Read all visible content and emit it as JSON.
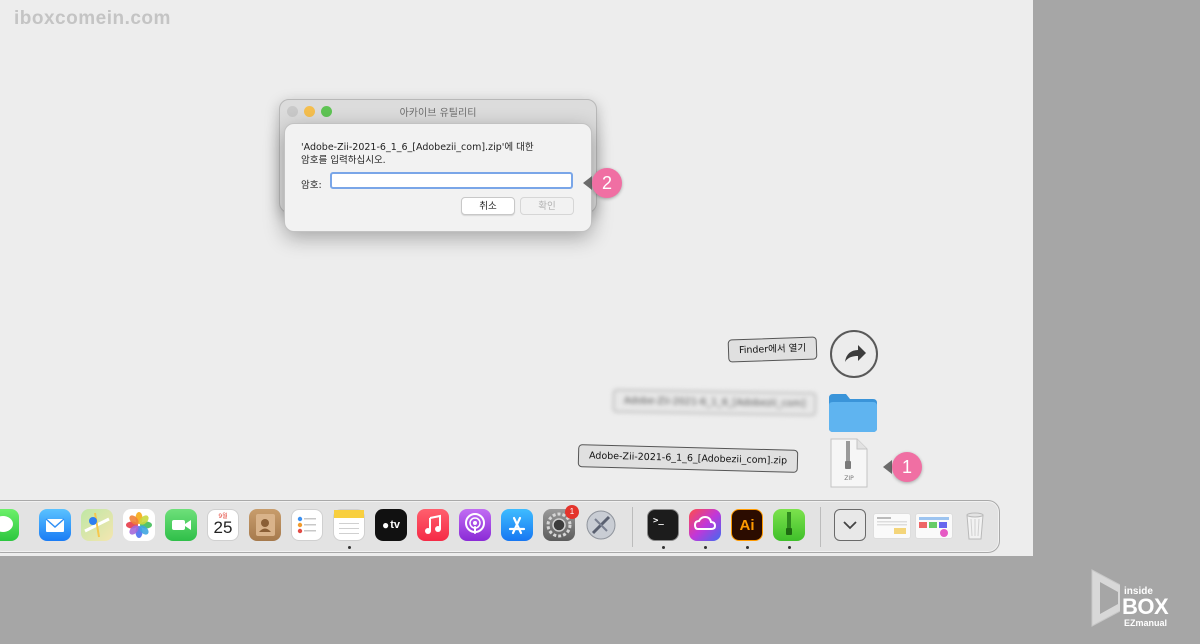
{
  "watermark": "iboxcomein.com",
  "archive_window": {
    "title": "아카이브 유틸리티"
  },
  "dialog": {
    "message_line1": "'Adobe-Zii-2021-6_1_6_[Adobezii_com].zip'에 대한",
    "message_line2": "암호를 입력하십시오.",
    "password_label": "암호:",
    "password_value": "",
    "cancel_label": "취소",
    "ok_label": "확인"
  },
  "markers": {
    "one": "1",
    "two": "2"
  },
  "stack": {
    "open_in_finder": "Finder에서 열기",
    "folder_label": "Adobe-Zii-2021-6_1_6_[Adobezii_com]",
    "zip_label": "Adobe-Zii-2021-6_1_6_[Adobezii_com].zip",
    "zip_icon_text": "ZIP"
  },
  "dock": {
    "calendar_month": "9월",
    "calendar_day": "25",
    "appletv_label": "tv",
    "settings_badge": "1",
    "illustrator_label": "Ai"
  },
  "logo": {
    "inside": "inside",
    "box": "BOX",
    "ezmanual": "EZmanual"
  }
}
